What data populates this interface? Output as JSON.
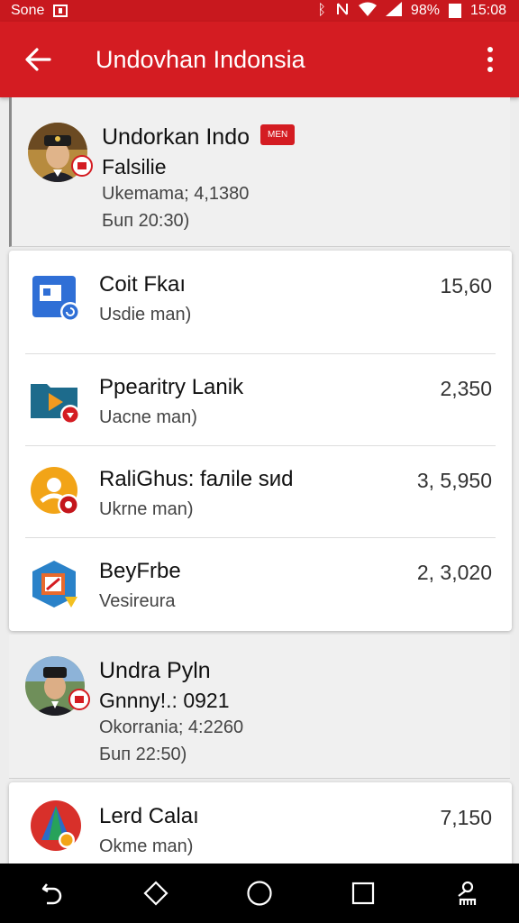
{
  "status_bar": {
    "carrier": "Sone",
    "battery_percent": "98%",
    "time": "15:08",
    "icons": [
      "notification-box-icon",
      "bluetooth-icon",
      "mute-icon",
      "wifi-icon",
      "signal-icon",
      "battery-icon"
    ]
  },
  "app_bar": {
    "title": "Undovhan Indonsia",
    "back_icon": "arrow-left-icon",
    "menu_icon": "more-vert-icon"
  },
  "contacts": [
    {
      "name": "Undorkan Indo",
      "badge": "MEN",
      "line2": "Falsilie",
      "line3": "Ukemama; 4,1380",
      "line4": "Бuп 20:30)"
    },
    {
      "name": "Undra Pyln",
      "line2": "Gnnny!.:  0921",
      "line3": "Okorrania; 4:2260",
      "line4": "Бuп 22:50)"
    }
  ],
  "card1": [
    {
      "title": "Coit Fkaı",
      "subtitle": "Usdie man)",
      "amount": "15,60",
      "icon": "image-app-icon",
      "color": "#2f6fd6"
    },
    {
      "title": "Ppearitry Lanik",
      "subtitle": "Uacne man)",
      "amount": "2,350",
      "icon": "folder-video-icon",
      "color": "#1d6b8c"
    },
    {
      "title": "RaliGhus: fалile sиd",
      "subtitle": "Ukrne man)",
      "amount": "3, 5,950",
      "icon": "user-circle-icon",
      "color": "#f2a417"
    },
    {
      "title": "BeyFrbe",
      "subtitle": "Vesireura",
      "amount": "2, 3,020",
      "icon": "edit-hexagon-icon",
      "color": "#2a82c9"
    }
  ],
  "card2": [
    {
      "title": "Lerd Calaı",
      "subtitle": "Okme man)",
      "amount": "7,150",
      "icon": "colorful-tent-icon",
      "color": "#d8302a"
    }
  ],
  "nav_bar": {
    "icons": [
      "back-nav-icon",
      "diamond-icon",
      "home-circle-icon",
      "recents-square-icon",
      "accessibility-icon"
    ]
  }
}
